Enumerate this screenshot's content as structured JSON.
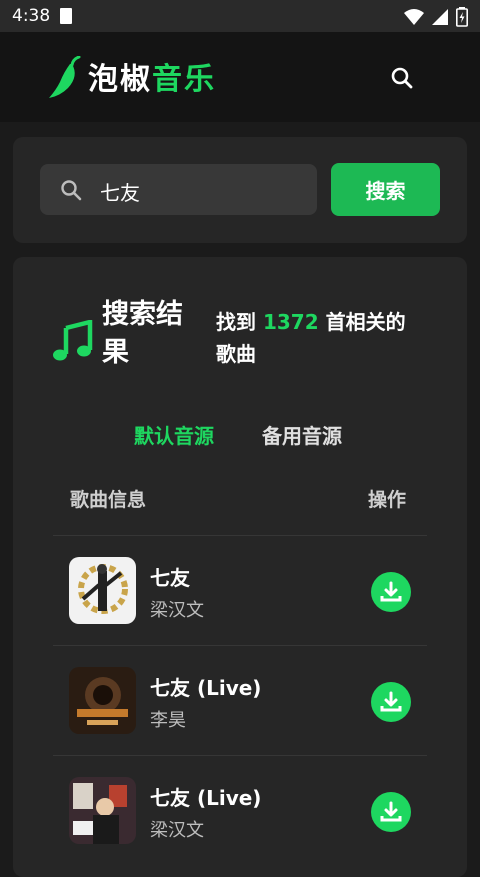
{
  "status_bar": {
    "time": "4:38"
  },
  "app": {
    "name_part1": "泡椒",
    "name_part2": "音乐",
    "brand_color": "#1ed760",
    "logo_icon": "chili-pepper-icon",
    "search_icon": "search-icon"
  },
  "search": {
    "value": "七友",
    "button_label": "搜索"
  },
  "results": {
    "title": "搜索结果",
    "count_prefix": "找到 ",
    "count": "1372",
    "count_suffix": " 首相关的歌曲",
    "tabs": [
      {
        "label": "默认音源",
        "active": true
      },
      {
        "label": "备用音源",
        "active": false
      }
    ],
    "columns": {
      "info": "歌曲信息",
      "action": "操作"
    },
    "songs": [
      {
        "title": "七友",
        "artist": "梁汉文"
      },
      {
        "title": "七友 (Live)",
        "artist": "李昊"
      },
      {
        "title": "七友 (Live)",
        "artist": "梁汉文"
      }
    ]
  }
}
